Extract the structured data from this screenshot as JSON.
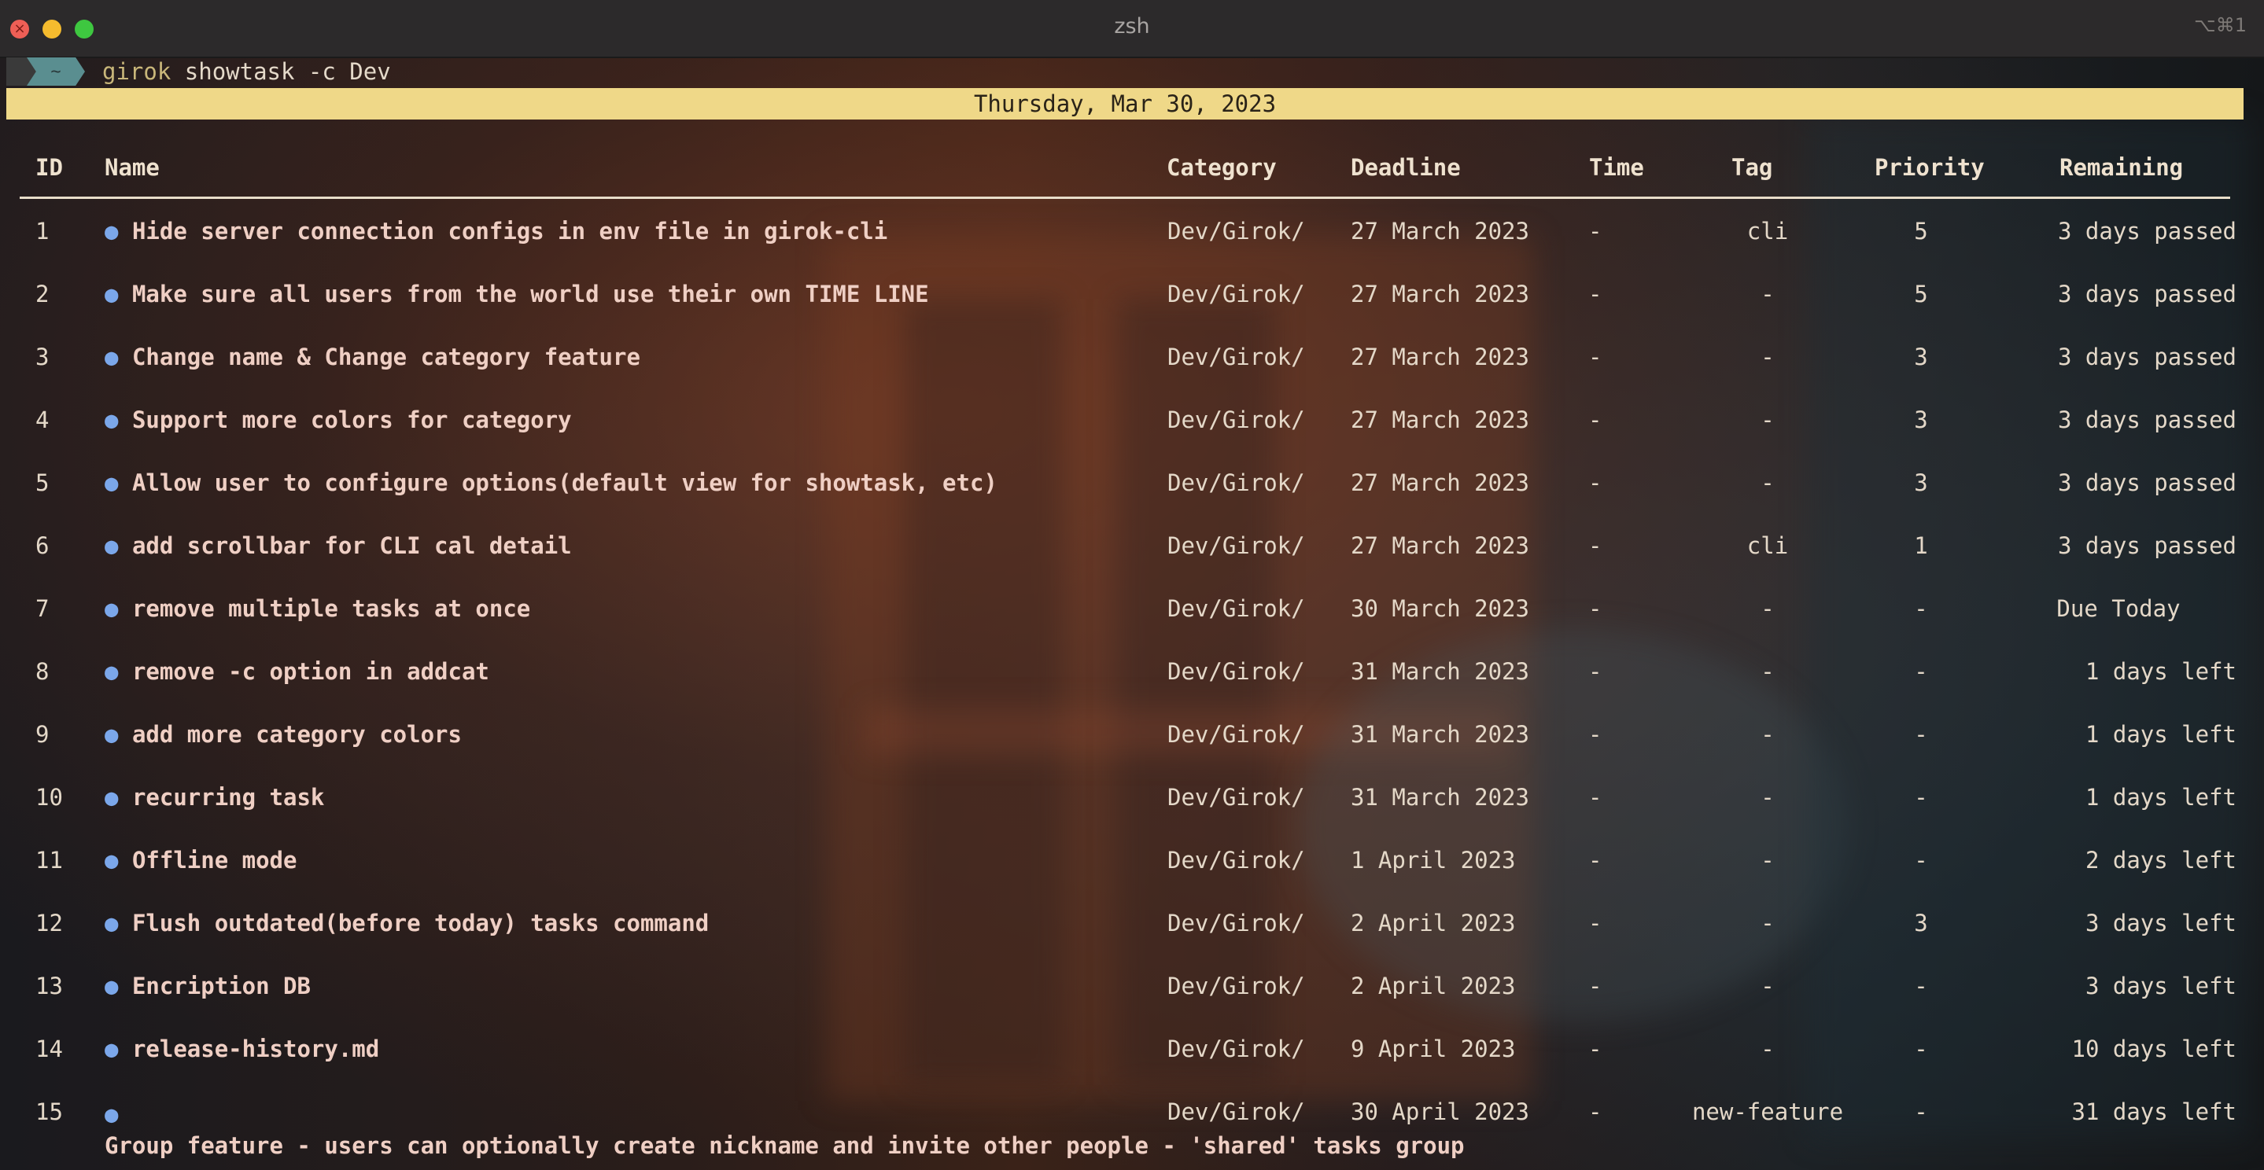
{
  "window": {
    "title": "zsh",
    "shortcut": "⌥⌘1"
  },
  "prompt": {
    "dir": "~",
    "bin": "girok",
    "args": " showtask -c Dev"
  },
  "date_banner": "Thursday, Mar 30, 2023",
  "table": {
    "headers": {
      "id": "ID",
      "name": "Name",
      "category": "Category",
      "deadline": "Deadline",
      "time": "Time",
      "tag": "Tag",
      "priority": "Priority",
      "remaining": "Remaining"
    },
    "bullet": "●",
    "rows": [
      {
        "id": "1",
        "name": "Hide server connection configs in env file in girok-cli",
        "category": "Dev/Girok/",
        "deadline": "27 March 2023",
        "time": "-",
        "tag": "cli",
        "priority": "5",
        "remaining": "3 days passed"
      },
      {
        "id": "2",
        "name": "Make sure all users from the world use their own TIME LINE",
        "category": "Dev/Girok/",
        "deadline": "27 March 2023",
        "time": "-",
        "tag": "-",
        "priority": "5",
        "remaining": "3 days passed"
      },
      {
        "id": "3",
        "name": "Change name & Change category feature",
        "category": "Dev/Girok/",
        "deadline": "27 March 2023",
        "time": "-",
        "tag": "-",
        "priority": "3",
        "remaining": "3 days passed"
      },
      {
        "id": "4",
        "name": "Support more colors for category",
        "category": "Dev/Girok/",
        "deadline": "27 March 2023",
        "time": "-",
        "tag": "-",
        "priority": "3",
        "remaining": "3 days passed"
      },
      {
        "id": "5",
        "name": "Allow user to configure options(default view for showtask, etc)",
        "category": "Dev/Girok/",
        "deadline": "27 March 2023",
        "time": "-",
        "tag": "-",
        "priority": "3",
        "remaining": "3 days passed"
      },
      {
        "id": "6",
        "name": "add scrollbar for CLI cal detail",
        "category": "Dev/Girok/",
        "deadline": "27 March 2023",
        "time": "-",
        "tag": "cli",
        "priority": "1",
        "remaining": "3 days passed"
      },
      {
        "id": "7",
        "name": "remove multiple tasks at once",
        "category": "Dev/Girok/",
        "deadline": "30 March 2023",
        "time": "-",
        "tag": "-",
        "priority": "-",
        "remaining": "Due Today"
      },
      {
        "id": "8",
        "name": "remove -c option in addcat",
        "category": "Dev/Girok/",
        "deadline": "31 March 2023",
        "time": "-",
        "tag": "-",
        "priority": "-",
        "remaining": "1 days left"
      },
      {
        "id": "9",
        "name": "add more category colors",
        "category": "Dev/Girok/",
        "deadline": "31 March 2023",
        "time": "-",
        "tag": "-",
        "priority": "-",
        "remaining": "1 days left"
      },
      {
        "id": "10",
        "name": "recurring task",
        "category": "Dev/Girok/",
        "deadline": "31 March 2023",
        "time": "-",
        "tag": "-",
        "priority": "-",
        "remaining": "1 days left"
      },
      {
        "id": "11",
        "name": "Offline mode",
        "category": "Dev/Girok/",
        "deadline": "1 April 2023",
        "time": "-",
        "tag": "-",
        "priority": "-",
        "remaining": "2 days left"
      },
      {
        "id": "12",
        "name": "Flush outdated(before today) tasks command",
        "category": "Dev/Girok/",
        "deadline": "2 April 2023",
        "time": "-",
        "tag": "-",
        "priority": "3",
        "remaining": "3 days left"
      },
      {
        "id": "13",
        "name": "Encription DB",
        "category": "Dev/Girok/",
        "deadline": "2 April 2023",
        "time": "-",
        "tag": "-",
        "priority": "-",
        "remaining": "3 days left"
      },
      {
        "id": "14",
        "name": "release-history.md",
        "category": "Dev/Girok/",
        "deadline": "9 April 2023",
        "time": "-",
        "tag": "-",
        "priority": "-",
        "remaining": "10 days left"
      },
      {
        "id": "15",
        "name": "Group feature - users can optionally create nickname and invite other people - 'shared' tasks group",
        "category": "Dev/Girok/",
        "deadline": "30 April 2023",
        "time": "-",
        "tag": "new-feature",
        "priority": "-",
        "remaining": "31 days left"
      }
    ]
  }
}
